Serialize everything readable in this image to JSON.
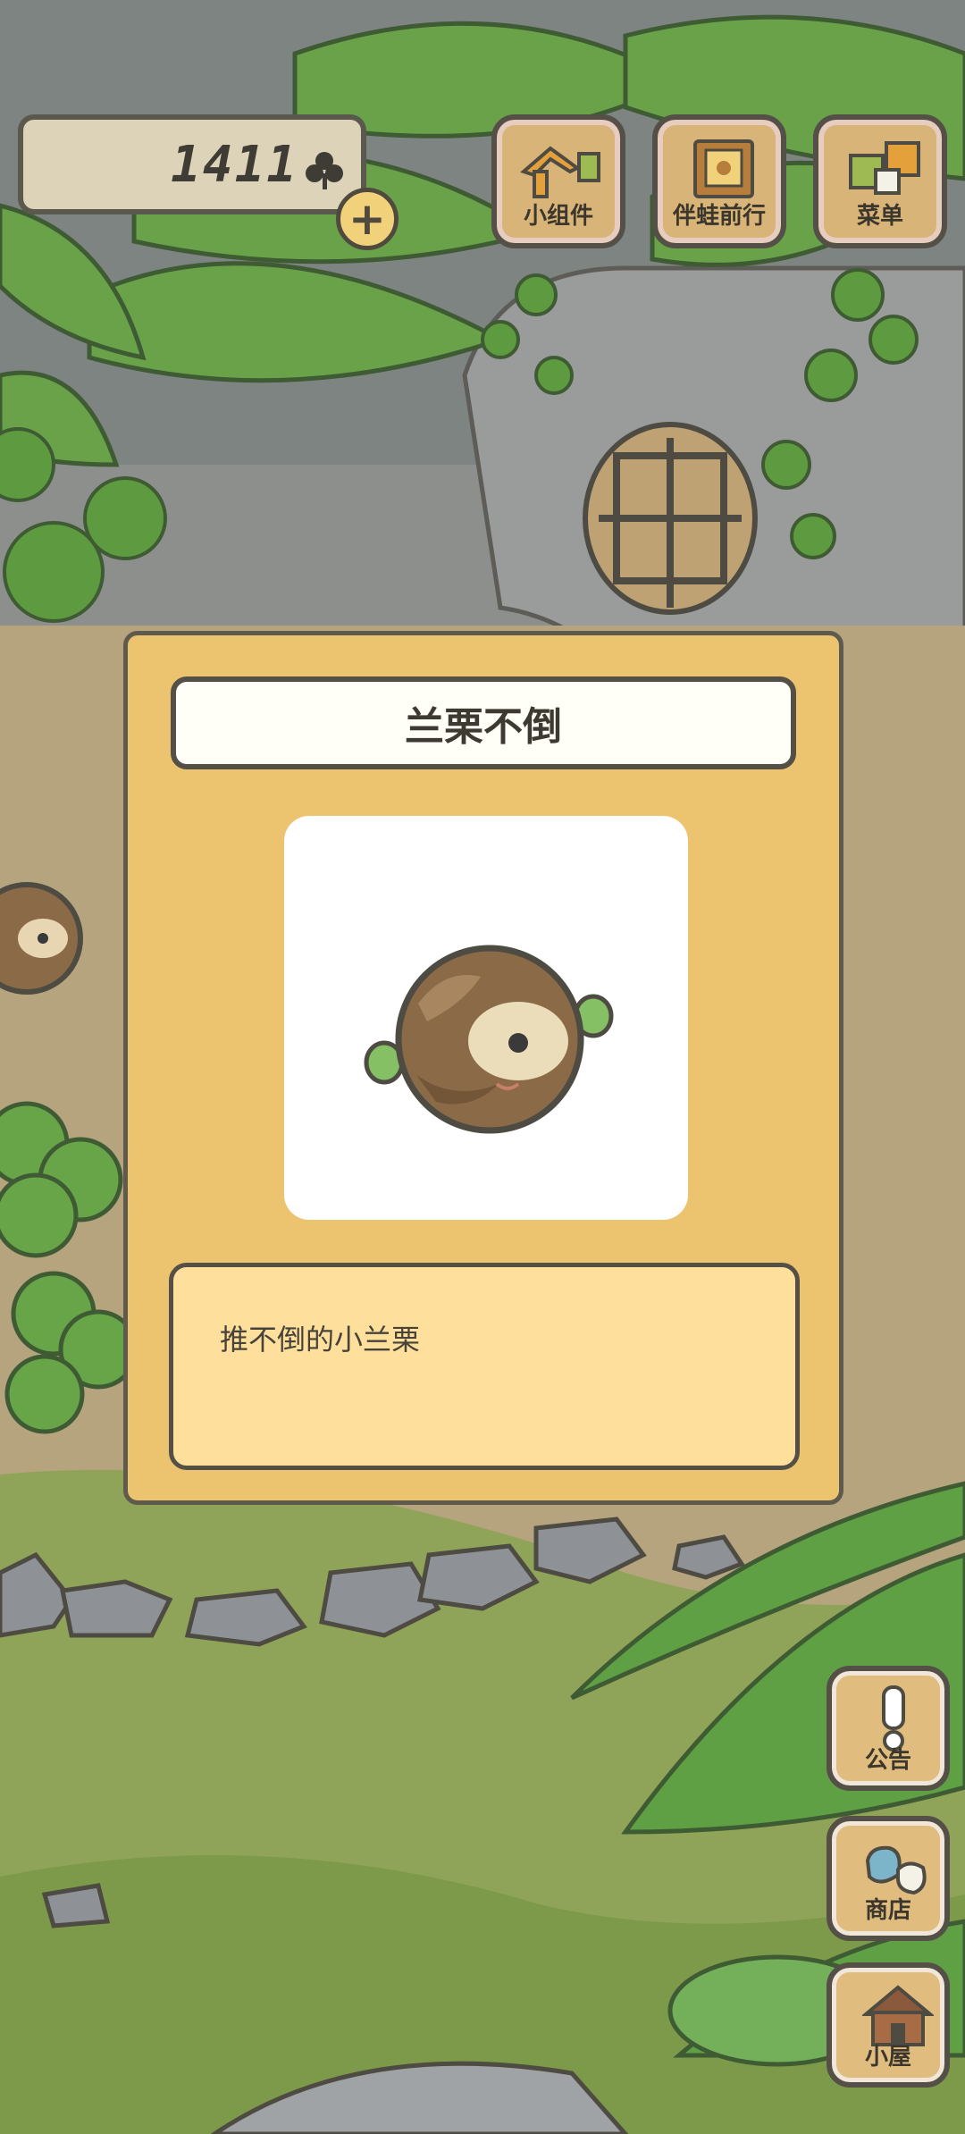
{
  "hud": {
    "clover_count": "1411",
    "clover_icon": "clover-icon",
    "add_icon": "plus-icon"
  },
  "top_menu": [
    {
      "label": "小组件",
      "icon": "widget-icon"
    },
    {
      "label": "伴蛙前行",
      "icon": "journal-icon"
    },
    {
      "label": "菜单",
      "icon": "menu-icon"
    }
  ],
  "side_menu": [
    {
      "label": "公告",
      "icon": "exclamation-icon"
    },
    {
      "label": "商店",
      "icon": "shop-bag-icon"
    },
    {
      "label": "小屋",
      "icon": "house-icon"
    }
  ],
  "item_dialog": {
    "title": "兰栗不倒",
    "description": "推不倒的小兰栗",
    "image_icon": "chestnut-tumbler-icon"
  },
  "colors": {
    "dialog_bg": "#ecc36e",
    "desc_bg": "#ffdf9c",
    "border": "#555047",
    "grass": "#7f9a4f"
  }
}
